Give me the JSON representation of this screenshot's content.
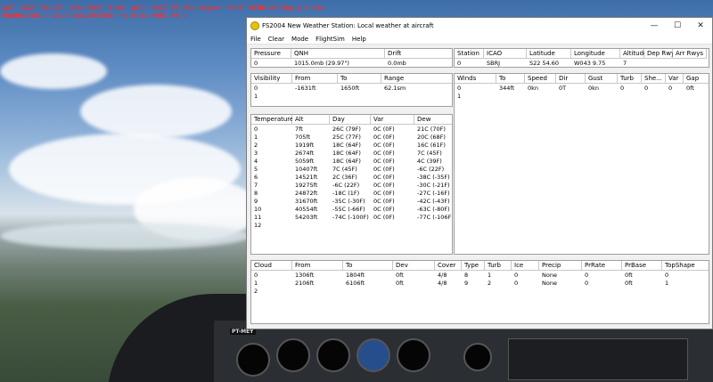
{
  "sim": {
    "hud_line1": "LAT: S22° 55.28'  LON: W43° 9.42'  ALT: +217 FT  MSL   Magvar +3.5°  WIND 23 Mag @ 1 Kts",
    "hud_line2": "FRAMES/SEC = 20.5  (UNLIMITED)  +1.0 Sc  FUEL 98 %",
    "tail_number": "PT-MEY"
  },
  "window": {
    "title": "FS2004 New Weather Station: Local weather at aircraft",
    "min_glyph": "—",
    "max_glyph": "☐",
    "close_glyph": "✕"
  },
  "menu": [
    "File",
    "Clear",
    "Mode",
    "FlightSim",
    "Help"
  ],
  "pressure": {
    "headers": [
      "Pressure",
      "QNH",
      "Drift"
    ],
    "rows": [
      [
        "0",
        "1015.0mb (29.97\")",
        "0.0mb"
      ]
    ]
  },
  "station": {
    "headers": [
      "Station",
      "ICAO",
      "Latitude",
      "Longitude",
      "Altitude",
      "Dep Rwys",
      "Arr Rwys"
    ],
    "rows": [
      [
        "0",
        "SBRJ",
        "S22 54.60",
        "W043 9.75",
        "7",
        "",
        ""
      ]
    ]
  },
  "visibility": {
    "headers": [
      "Visibility",
      "From",
      "To",
      "Range"
    ],
    "rows": [
      [
        "0",
        "-1631ft",
        "1650ft",
        "62.1sm"
      ],
      [
        "1",
        "",
        "",
        ""
      ]
    ]
  },
  "winds": {
    "headers": [
      "Winds",
      "To",
      "Speed",
      "Dir",
      "Gust",
      "Turb",
      "She...",
      "Var",
      "Gap"
    ],
    "rows": [
      [
        "0",
        "344ft",
        "0kn",
        "0T",
        "0kn",
        "0",
        "0",
        "0",
        "0ft"
      ],
      [
        "1",
        "",
        "",
        "",
        "",
        "",
        "",
        "",
        ""
      ]
    ]
  },
  "temperature": {
    "headers": [
      "Temperature",
      "Alt",
      "Day",
      "Var",
      "Dew"
    ],
    "rows": [
      [
        "0",
        "7ft",
        "26C (79F)",
        "0C (0F)",
        "21C (70F)"
      ],
      [
        "1",
        "705ft",
        "25C (77F)",
        "0C (0F)",
        "20C (68F)"
      ],
      [
        "2",
        "1919ft",
        "18C (64F)",
        "0C (0F)",
        "16C (61F)"
      ],
      [
        "3",
        "2674ft",
        "18C (64F)",
        "0C (0F)",
        "7C (45F)"
      ],
      [
        "4",
        "5059ft",
        "18C (64F)",
        "0C (0F)",
        "4C (39F)"
      ],
      [
        "5",
        "10407ft",
        "7C (45F)",
        "0C (0F)",
        "-6C (22F)"
      ],
      [
        "6",
        "14521ft",
        "2C (36F)",
        "0C (0F)",
        "-38C (-35F)"
      ],
      [
        "7",
        "19275ft",
        "-6C (22F)",
        "0C (0F)",
        "-30C (-21F)"
      ],
      [
        "8",
        "24872ft",
        "-18C (1F)",
        "0C (0F)",
        "-27C (-16F)"
      ],
      [
        "9",
        "31670ft",
        "-35C (-30F)",
        "0C (0F)",
        "-42C (-43F)"
      ],
      [
        "10",
        "40554ft",
        "-55C (-66F)",
        "0C (0F)",
        "-63C (-80F)"
      ],
      [
        "11",
        "54203ft",
        "-74C (-100F)",
        "0C (0F)",
        "-77C (-106F)"
      ],
      [
        "12",
        "",
        "",
        "",
        ""
      ]
    ]
  },
  "clouds": {
    "headers": [
      "Cloud",
      "From",
      "To",
      "Dev",
      "Cover",
      "Type",
      "Turb",
      "Ice",
      "Precip",
      "PrRate",
      "PrBase",
      "TopShape"
    ],
    "rows": [
      [
        "0",
        "1306ft",
        "1804ft",
        "0ft",
        "4/8",
        "8",
        "1",
        "0",
        "None",
        "0",
        "0ft",
        "0"
      ],
      [
        "1",
        "2106ft",
        "6106ft",
        "0ft",
        "4/8",
        "9",
        "2",
        "0",
        "None",
        "0",
        "0ft",
        "1"
      ],
      [
        "2",
        "",
        "",
        "",
        "",
        "",
        "",
        "",
        "",
        "",
        "",
        ""
      ]
    ]
  }
}
